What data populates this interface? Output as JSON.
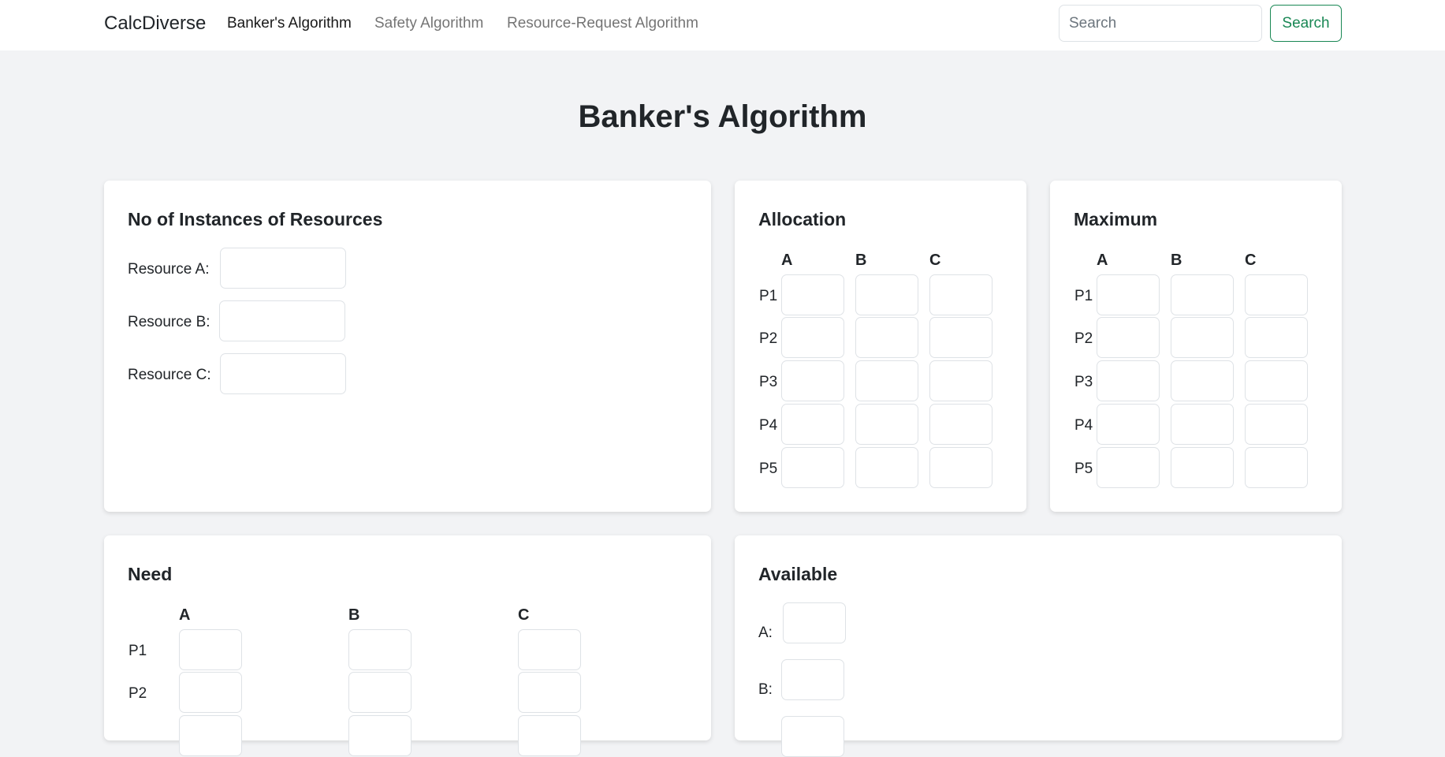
{
  "navbar": {
    "brand": "CalcDiverse",
    "links": [
      {
        "label": "Banker's Algorithm",
        "active": true
      },
      {
        "label": "Safety Algorithm",
        "active": false
      },
      {
        "label": "Resource-Request Algorithm",
        "active": false
      }
    ],
    "search_placeholder": "Search",
    "search_button": "Search",
    "accent_color": "#198754"
  },
  "page_title": "Banker's Algorithm",
  "instances": {
    "title": "No of Instances of Resources",
    "resources": [
      {
        "label": "Resource A:",
        "value": ""
      },
      {
        "label": "Resource B:",
        "value": ""
      },
      {
        "label": "Resource C:",
        "value": ""
      }
    ]
  },
  "allocation": {
    "title": "Allocation",
    "columns": [
      "A",
      "B",
      "C"
    ],
    "rows": [
      "P1",
      "P2",
      "P3",
      "P4",
      "P5"
    ]
  },
  "maximum": {
    "title": "Maximum",
    "columns": [
      "A",
      "B",
      "C"
    ],
    "rows": [
      "P1",
      "P2",
      "P3",
      "P4",
      "P5"
    ]
  },
  "need": {
    "title": "Need",
    "columns": [
      "A",
      "B",
      "C"
    ],
    "rows": [
      "P1",
      "P2"
    ]
  },
  "available": {
    "title": "Available",
    "items": [
      {
        "label": "A:",
        "value": ""
      },
      {
        "label": "B:",
        "value": ""
      }
    ]
  }
}
